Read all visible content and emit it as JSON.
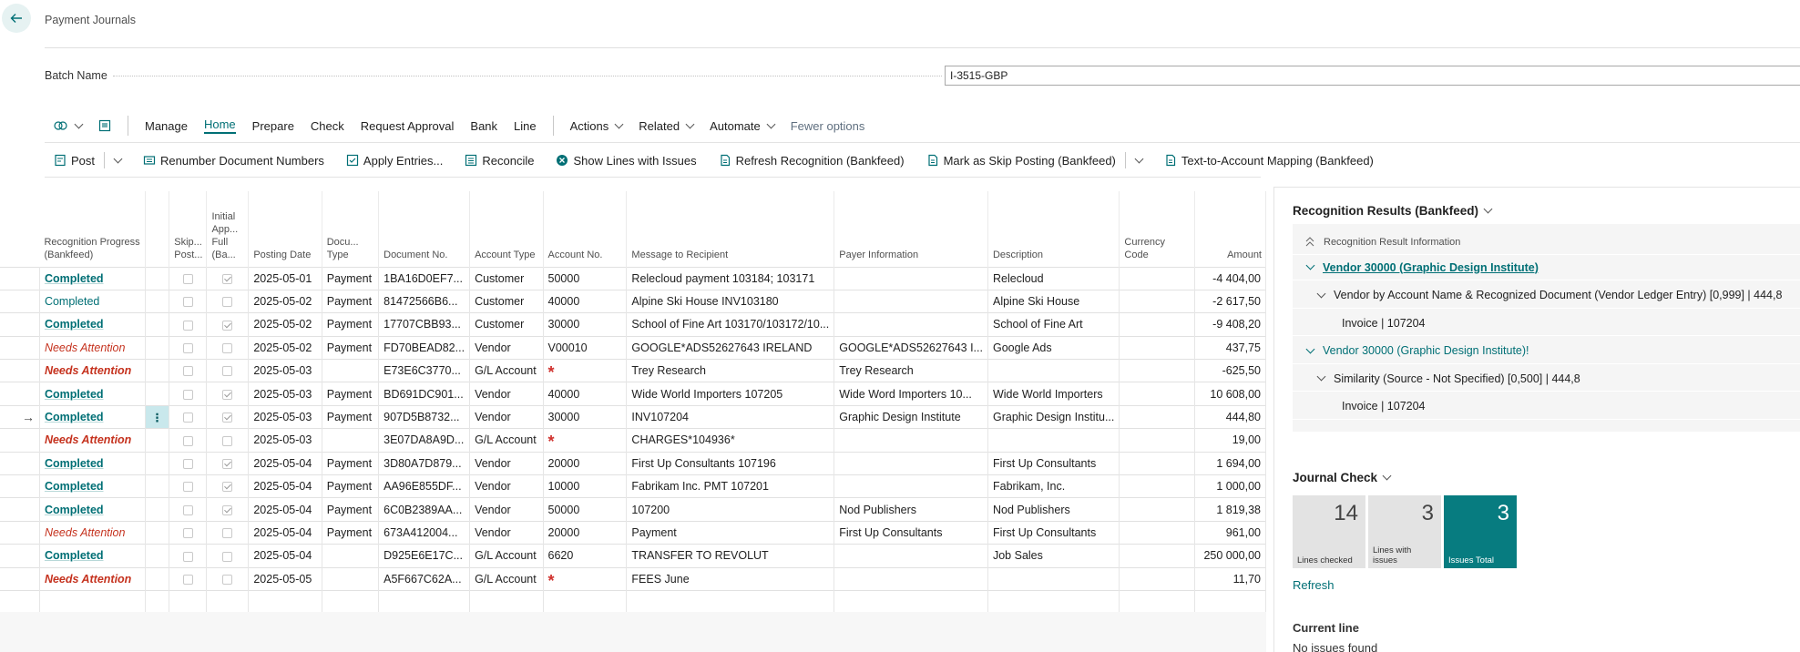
{
  "header": {
    "title": "Payment Journals",
    "batch_label": "Batch Name",
    "batch_value": "I-3515-GBP"
  },
  "actions": {
    "manage": "Manage",
    "home": "Home",
    "prepare": "Prepare",
    "check": "Check",
    "request_approval": "Request Approval",
    "bank": "Bank",
    "line": "Line",
    "actions_menu": "Actions",
    "related": "Related",
    "automate": "Automate",
    "fewer": "Fewer options"
  },
  "home_actions": {
    "post": "Post",
    "renumber": "Renumber Document Numbers",
    "apply": "Apply Entries...",
    "reconcile": "Reconcile",
    "show_issues": "Show Lines with Issues",
    "refresh_recognition": "Refresh Recognition (Bankfeed)",
    "mark_skip": "Mark as Skip Posting (Bankfeed)",
    "text_mapping": "Text-to-Account Mapping (Bankfeed)"
  },
  "columns": {
    "progress": "Recognition Progress (Bankfeed)",
    "skip": "Skip... Post...",
    "initial": "Initial App... Full (Ba...",
    "posting_date": "Posting Date",
    "doc_type": "Docu... Type",
    "doc_no": "Document No.",
    "acc_type": "Account Type",
    "acc_no": "Account No.",
    "message": "Message to Recipient",
    "payer": "Payer Information",
    "description": "Description",
    "currency": "Currency Code",
    "amount": "Amount"
  },
  "rows": [
    {
      "status": "Completed",
      "style": "completed-b",
      "initial": true,
      "date": "2025-05-01",
      "doc_type": "Payment",
      "doc_no": "1BA16D0EF7...",
      "acc_type": "Customer",
      "acc_no": "50000",
      "message": "Relecloud payment 103184; 103171",
      "payer": "",
      "description": "Relecloud",
      "amount": "-4 404,00"
    },
    {
      "status": "Completed",
      "style": "completed",
      "initial": false,
      "date": "2025-05-02",
      "doc_type": "Payment",
      "doc_no": "81472566B6...",
      "acc_type": "Customer",
      "acc_no": "40000",
      "message": "Alpine Ski House INV103180",
      "payer": "",
      "description": "Alpine Ski House",
      "amount": "-2 617,50"
    },
    {
      "status": "Completed",
      "style": "completed-b",
      "initial": true,
      "date": "2025-05-02",
      "doc_type": "Payment",
      "doc_no": "17707CBB93...",
      "acc_type": "Customer",
      "acc_no": "30000",
      "message": "School of Fine Art 103170/103172/10...",
      "payer": "",
      "description": "School of Fine Art",
      "amount": "-9 408,20"
    },
    {
      "status": "Needs Attention",
      "style": "attn",
      "initial": false,
      "date": "2025-05-02",
      "doc_type": "Payment",
      "doc_no": "FD70BEAD82...",
      "acc_type": "Vendor",
      "acc_no": "V00010",
      "message": "GOOGLE*ADS52627643 IRELAND",
      "payer": "GOOGLE*ADS52627643 I...",
      "description": "Google Ads",
      "amount": "437,75"
    },
    {
      "status": "Needs Attention",
      "style": "attn-b",
      "initial": false,
      "date": "2025-05-03",
      "doc_type": "",
      "doc_no": "E73E6C3770...",
      "acc_type": "G/L Account",
      "acc_no": "",
      "required": true,
      "message": "Trey Research",
      "payer": "Trey Research",
      "description": "",
      "amount": "-625,50"
    },
    {
      "status": "Completed",
      "style": "completed-b",
      "initial": true,
      "date": "2025-05-03",
      "doc_type": "Payment",
      "doc_no": "BD691DC901...",
      "acc_type": "Vendor",
      "acc_no": "40000",
      "message": "Wide World Importers 107205",
      "payer": "Wide Word Importers 10...",
      "description": "Wide World Importers",
      "amount": "10 608,00"
    },
    {
      "status": "Completed",
      "style": "completed-b",
      "initial": true,
      "current": true,
      "date": "2025-05-03",
      "doc_type": "Payment",
      "doc_no": "907D5B8732...",
      "acc_type": "Vendor",
      "acc_no": "30000",
      "message": "INV107204",
      "payer": "Graphic Design Institute",
      "description": "Graphic Design Institu...",
      "amount": "444,80"
    },
    {
      "status": "Needs Attention",
      "style": "attn-b",
      "initial": false,
      "date": "2025-05-03",
      "doc_type": "",
      "doc_no": "3E07DA8A9D...",
      "acc_type": "G/L Account",
      "acc_no": "",
      "required": true,
      "message": "CHARGES*104936*",
      "payer": "",
      "description": "",
      "amount": "19,00"
    },
    {
      "status": "Completed",
      "style": "completed-b",
      "initial": true,
      "date": "2025-05-04",
      "doc_type": "Payment",
      "doc_no": "3D80A7D879...",
      "acc_type": "Vendor",
      "acc_no": "20000",
      "message": "First Up Consultants 107196",
      "payer": "",
      "description": "First Up Consultants",
      "amount": "1 694,00"
    },
    {
      "status": "Completed",
      "style": "completed-b",
      "initial": true,
      "date": "2025-05-04",
      "doc_type": "Payment",
      "doc_no": "AA96E855DF...",
      "acc_type": "Vendor",
      "acc_no": "10000",
      "message": "Fabrikam Inc. PMT 107201",
      "payer": "",
      "description": "Fabrikam, Inc.",
      "amount": "1 000,00"
    },
    {
      "status": "Completed",
      "style": "completed-b",
      "initial": true,
      "date": "2025-05-04",
      "doc_type": "Payment",
      "doc_no": "6C0B2389AA...",
      "acc_type": "Vendor",
      "acc_no": "50000",
      "message": "107200",
      "payer": "Nod Publishers",
      "description": "Nod Publishers",
      "amount": "1 819,38"
    },
    {
      "status": "Needs Attention",
      "style": "attn",
      "initial": false,
      "date": "2025-05-04",
      "doc_type": "Payment",
      "doc_no": "673A412004...",
      "acc_type": "Vendor",
      "acc_no": "20000",
      "message": "Payment",
      "payer": "First Up Consultants",
      "description": "First Up Consultants",
      "amount": "961,00"
    },
    {
      "status": "Completed",
      "style": "completed-b",
      "initial": false,
      "date": "2025-05-04",
      "doc_type": "",
      "doc_no": "D925E6E17C...",
      "acc_type": "G/L Account",
      "acc_no": "6620",
      "message": "TRANSFER TO REVOLUT",
      "payer": "",
      "description": "Job Sales",
      "amount": "250 000,00"
    },
    {
      "status": "Needs Attention",
      "style": "attn-b",
      "initial": false,
      "date": "2025-05-05",
      "doc_type": "",
      "doc_no": "A5F667C62A...",
      "acc_type": "G/L Account",
      "acc_no": "",
      "required": true,
      "message": "FEES June",
      "payer": "",
      "description": "",
      "amount": "11,70"
    }
  ],
  "recognition": {
    "title": "Recognition Results (Bankfeed)",
    "info_header": "Recognition Result Information",
    "items": [
      {
        "text": "Vendor 30000 (Graphic Design Institute)",
        "level": 0,
        "style": "link-b"
      },
      {
        "text": "Vendor by Account Name & Recognized Document (Vendor Ledger Entry) [0,999] | 444,8",
        "level": 1,
        "style": "plain"
      },
      {
        "text": "Invoice | 107204",
        "level": 2,
        "style": "plain"
      },
      {
        "text": "Vendor 30000 (Graphic Design Institute)!",
        "level": 0,
        "style": "link"
      },
      {
        "text": "Similarity (Source - Not Specified) [0,500] | 444,8",
        "level": 1,
        "style": "plain"
      },
      {
        "text": "Invoice | 107204",
        "level": 2,
        "style": "plain"
      }
    ]
  },
  "journal_check": {
    "title": "Journal Check",
    "tiles": [
      {
        "value": "14",
        "label": "Lines checked",
        "primary": false
      },
      {
        "value": "3",
        "label": "Lines with issues",
        "primary": false
      },
      {
        "value": "3",
        "label": "Issues Total",
        "primary": true
      }
    ],
    "refresh": "Refresh",
    "current_line_title": "Current line",
    "current_line_value": "No issues found"
  },
  "colors": {
    "accent": "#006f75",
    "attention": "#c5321e",
    "tile_primary": "#077c80"
  }
}
